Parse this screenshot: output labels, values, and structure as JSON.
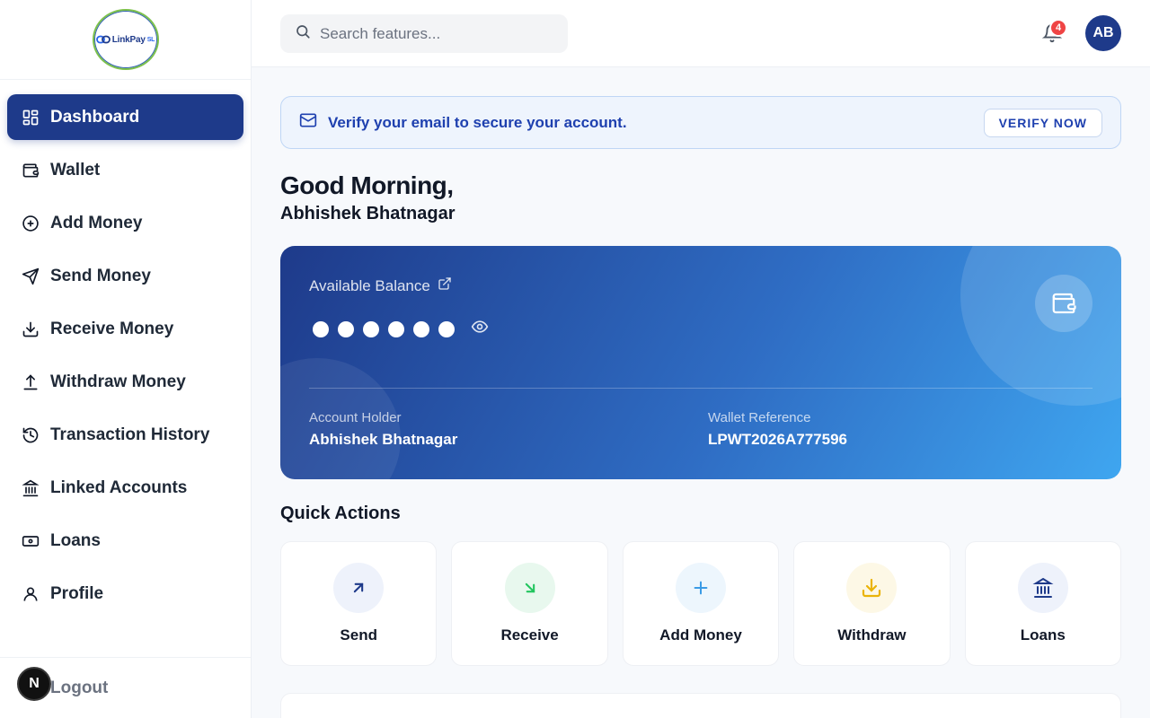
{
  "brand": {
    "logo_text": "LinkPay",
    "logo_suffix": "SL"
  },
  "sidebar": {
    "items": [
      {
        "label": "Dashboard",
        "icon": "grid-icon",
        "active": true
      },
      {
        "label": "Wallet",
        "icon": "wallet-icon"
      },
      {
        "label": "Add Money",
        "icon": "plus-circle-icon"
      },
      {
        "label": "Send Money",
        "icon": "send-icon"
      },
      {
        "label": "Receive Money",
        "icon": "download-icon"
      },
      {
        "label": "Withdraw Money",
        "icon": "upload-icon"
      },
      {
        "label": "Transaction History",
        "icon": "history-icon"
      },
      {
        "label": "Linked Accounts",
        "icon": "bank-icon"
      },
      {
        "label": "Loans",
        "icon": "banknote-icon"
      },
      {
        "label": "Profile",
        "icon": "user-icon"
      }
    ],
    "logout_label": "Logout",
    "dev_badge": "N"
  },
  "header": {
    "search_placeholder": "Search features...",
    "notification_count": "4",
    "avatar_initials": "AB"
  },
  "verify_banner": {
    "text": "Verify your email to secure your account.",
    "button_label": "VERIFY NOW"
  },
  "greeting": {
    "line1": "Good Morning,",
    "name": "Abhishek Bhatnagar"
  },
  "balance_card": {
    "label": "Available Balance",
    "masked_dot_count": 6,
    "account_holder_label": "Account Holder",
    "account_holder_value": "Abhishek Bhatnagar",
    "wallet_ref_label": "Wallet Reference",
    "wallet_ref_value": "LPWT2026A777596"
  },
  "quick_actions": {
    "title": "Quick Actions",
    "items": [
      {
        "label": "Send",
        "icon": "arrow-up-right-icon",
        "bg": "#eef2fb",
        "color": "#1e3a8a"
      },
      {
        "label": "Receive",
        "icon": "arrow-down-right-icon",
        "bg": "#e8f8ee",
        "color": "#22c55e"
      },
      {
        "label": "Add Money",
        "icon": "plus-icon",
        "bg": "#edf6fd",
        "color": "#3b9be6"
      },
      {
        "label": "Withdraw",
        "icon": "download-icon",
        "bg": "#fdf8e6",
        "color": "#eab308"
      },
      {
        "label": "Loans",
        "icon": "bank-icon",
        "bg": "#eef2fb",
        "color": "#1e3a8a"
      }
    ]
  },
  "colors": {
    "primary": "#1e3a8a",
    "danger": "#ef4444",
    "accent": "#3fa6f0"
  }
}
